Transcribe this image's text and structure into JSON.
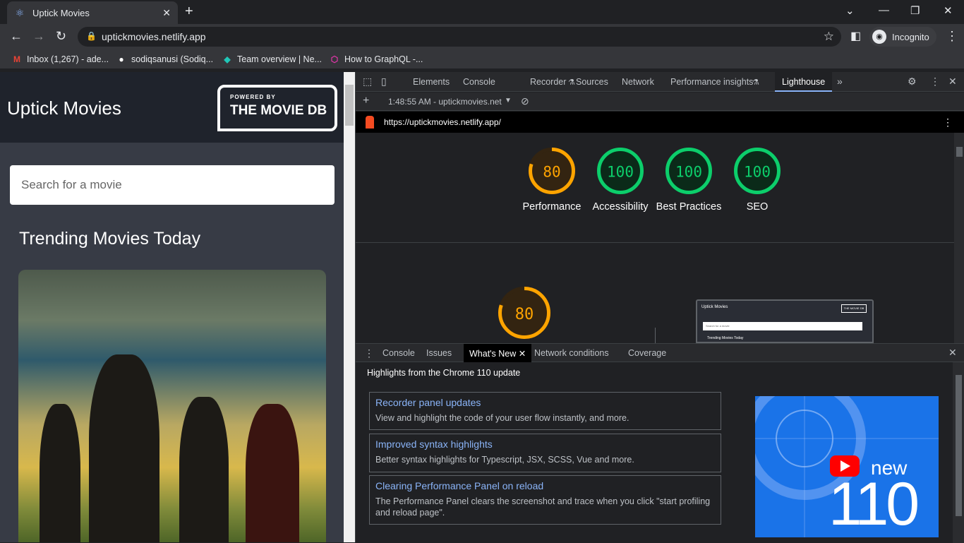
{
  "browser": {
    "tab_title": "Uptick Movies",
    "url": "uptickmovies.netlify.app",
    "incognito_label": "Incognito",
    "bookmarks": [
      {
        "label": "Inbox (1,267) - ade...",
        "icon": "gmail-icon",
        "color": "#ea4335"
      },
      {
        "label": "sodiqsanusi (Sodiq...",
        "icon": "github-icon",
        "color": "#ffffff"
      },
      {
        "label": "Team overview | Ne...",
        "icon": "netlify-icon",
        "color": "#20c6b7"
      },
      {
        "label": "How to GraphQL -...",
        "icon": "graphql-icon",
        "color": "#e535ab"
      }
    ]
  },
  "site": {
    "title": "Uptick Movies",
    "tmdb_powered": "POWERED BY",
    "tmdb_name": "THE MOVIE DB",
    "search_placeholder": "Search for a movie",
    "trending_heading": "Trending Movies Today"
  },
  "devtools": {
    "tabs": [
      "Elements",
      "Console",
      "Recorder",
      "Sources",
      "Network",
      "Performance insights",
      "Lighthouse"
    ],
    "active_tab": "Lighthouse",
    "report_time": "1:48:55 AM - uptickmovies.net",
    "report_url": "https://uptickmovies.netlify.app/",
    "scores": [
      {
        "label": "Performance",
        "value": 80,
        "color": "#ffa400"
      },
      {
        "label": "Accessibility",
        "value": 100,
        "color": "#0cce6b"
      },
      {
        "label": "Best Practices",
        "value": 100,
        "color": "#0cce6b"
      },
      {
        "label": "SEO",
        "value": 100,
        "color": "#0cce6b"
      }
    ],
    "big_score": {
      "value": 80,
      "color": "#ffa400"
    },
    "drawer": {
      "tabs": [
        "Console",
        "Issues",
        "What's New",
        "Network conditions",
        "Coverage"
      ],
      "active_tab": "What's New",
      "heading": "Highlights from the Chrome 110 update",
      "cards": [
        {
          "title": "Recorder panel updates",
          "desc": "View and highlight the code of your user flow instantly, and more."
        },
        {
          "title": "Improved syntax highlights",
          "desc": "Better syntax highlights for Typescript, JSX, SCSS, Vue and more."
        },
        {
          "title": "Clearing Performance Panel on reload",
          "desc": "The Performance Panel clears the screenshot and trace when you click \"start profiling and reload page\"."
        }
      ],
      "promo_word": "new",
      "promo_number": "110"
    },
    "thumb": {
      "title": "Uptick Movies",
      "logo": "THE MOVIE DB",
      "search": "Search for a movie",
      "heading": "Trending Movies Today"
    }
  }
}
